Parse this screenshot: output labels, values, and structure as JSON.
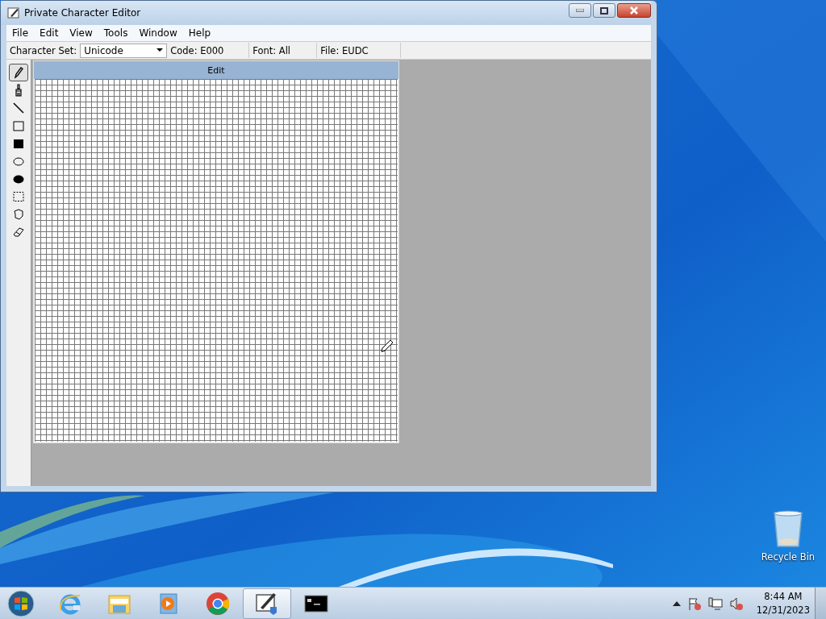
{
  "window": {
    "title": "Private Character Editor"
  },
  "menu": [
    "File",
    "Edit",
    "View",
    "Tools",
    "Window",
    "Help"
  ],
  "toolbar": {
    "charset_label": "Character Set:",
    "charset_value": "Unicode",
    "fields": [
      "Code: E000",
      "Font: All",
      "File: EUDC"
    ]
  },
  "tools": [
    {
      "kind": "pencil",
      "selected": true
    },
    {
      "kind": "brush",
      "selected": false
    },
    {
      "kind": "line",
      "selected": false
    },
    {
      "kind": "rect",
      "selected": false
    },
    {
      "kind": "filled-rect",
      "selected": false
    },
    {
      "kind": "ellipse",
      "selected": false
    },
    {
      "kind": "filled-ellipse",
      "selected": false
    },
    {
      "kind": "rect-select",
      "selected": false
    },
    {
      "kind": "free-select",
      "selected": false
    },
    {
      "kind": "eraser",
      "selected": false
    }
  ],
  "edit_window": {
    "title": "Edit"
  },
  "desktop_icons": [
    {
      "label": "Recycle Bin"
    }
  ],
  "taskbar": {
    "apps": [
      {
        "kind": "ie",
        "selected": false
      },
      {
        "kind": "explorer",
        "selected": false
      },
      {
        "kind": "media",
        "selected": false
      },
      {
        "kind": "chrome",
        "selected": false
      },
      {
        "kind": "editor",
        "selected": true
      },
      {
        "kind": "cmd",
        "selected": false
      }
    ],
    "time": "8:44 AM",
    "date": "12/31/2023"
  }
}
